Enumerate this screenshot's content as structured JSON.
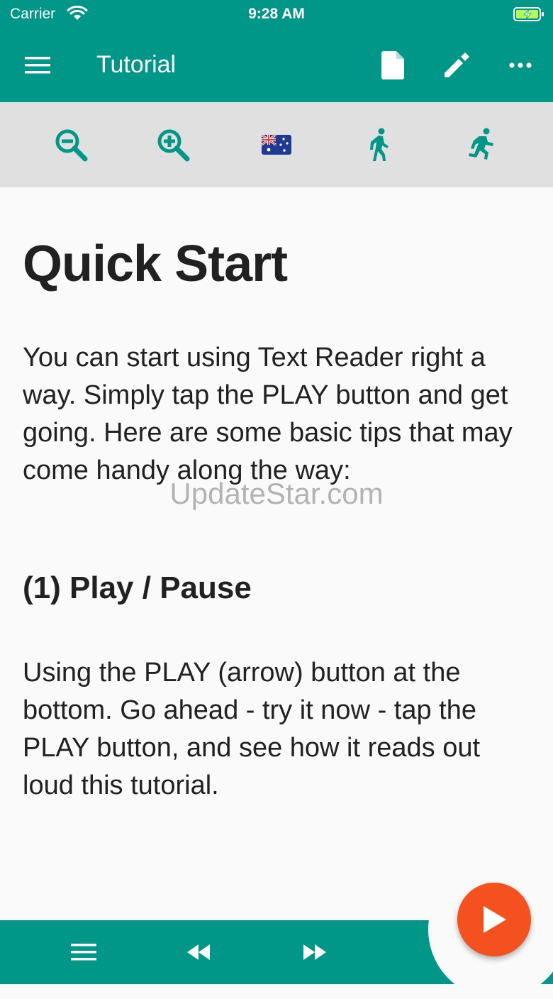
{
  "status": {
    "carrier": "Carrier",
    "time": "9:28 AM",
    "wifi_icon": "wifi-icon",
    "battery_icon": "battery-charging-icon"
  },
  "appbar": {
    "title": "Tutorial",
    "menu_icon": "hamburger-menu-icon",
    "actions": [
      "document-icon",
      "pencil-icon",
      "more-horizontal-icon"
    ]
  },
  "toolbar": {
    "items": [
      "zoom-out-icon",
      "zoom-in-icon",
      "australia-flag-icon",
      "walking-icon",
      "running-icon"
    ]
  },
  "content": {
    "heading": "Quick Start",
    "intro": "You can start using Text Reader right a way. Simply tap the PLAY button and get going. Here are some basic tips that may come handy along the way:",
    "section_heading": "(1) Play / Pause",
    "section_text": "Using the PLAY (arrow) button at the bottom. Go ahead - try it now - tap the PLAY button, and see how it reads out loud this tutorial."
  },
  "watermark": "UpdateStar.com",
  "bottom": {
    "items": [
      "list-menu-icon",
      "rewind-icon",
      "fast-forward-icon"
    ],
    "fab_icon": "play-icon"
  },
  "colors": {
    "primary": "#009688",
    "toolbar_bg": "#e0e0e0",
    "accent": "#f4511e",
    "text": "#212121"
  }
}
